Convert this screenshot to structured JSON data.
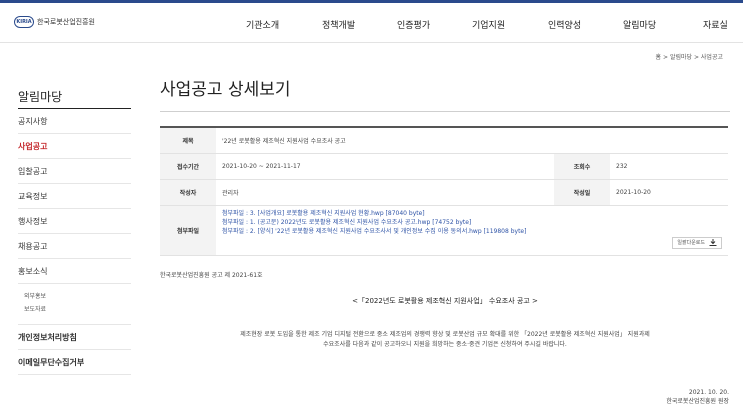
{
  "header": {
    "logo_mark": "KIRIA",
    "logo_text": "한국로봇산업진흥원",
    "logo_sub": "KOREA INSTITUTE FOR ROBOT INDUSTRY ADVANCEMENT",
    "nav": [
      "기관소개",
      "정책개발",
      "인증평가",
      "기업지원",
      "인력양성",
      "알림마당",
      "자료실"
    ]
  },
  "breadcrumb": {
    "home": "홈",
    "sep": ">",
    "level1": "알림마당",
    "level2": "사업공고"
  },
  "sidebar": {
    "title": "알림마당",
    "items": [
      {
        "label": "공지사항",
        "active": false
      },
      {
        "label": "사업공고",
        "active": true
      },
      {
        "label": "입찰공고",
        "active": false
      },
      {
        "label": "교육정보",
        "active": false
      },
      {
        "label": "행사정보",
        "active": false
      },
      {
        "label": "채용공고",
        "active": false
      },
      {
        "label": "홍보소식",
        "active": false
      }
    ],
    "sub_items": [
      "외부홍보",
      "보도자료"
    ],
    "bottom_items": [
      "개인정보처리방침",
      "이메일무단수집거부"
    ]
  },
  "main": {
    "page_title": "사업공고 상세보기",
    "detail": {
      "subject_label": "제목",
      "subject": "'22년 로봇활용 제조혁신 지원사업 수요조사 공고",
      "period_label": "접수기간",
      "period": "2021-10-20 ~ 2021-11-17",
      "views_label": "조회수",
      "views": "232",
      "author_label": "작성자",
      "author": "관리자",
      "date_label": "작성일",
      "date": "2021-10-20",
      "files_label": "첨부파일",
      "files": [
        "첨부파일 : 3. [사업개요] 로봇활용 제조혁신 지원사업 현황.hwp [87040 byte]",
        "첨부파일 : 1. (공고문) 2022년도 로봇활용 제조혁신 지원사업 수요조사 공고.hwp [74752 byte]",
        "첨부파일 : 2. [양식] '22년 로봇활용 제조혁신 지원사업 수요조사서 및 개인정보 수집 이용 동의서.hwp [119808 byte]"
      ],
      "zip_label": "일괄다운로드"
    },
    "notice_no": "한국로봇산업진흥원 공고 제 2021-61호",
    "announce_title": "<「2022년도 로봇활용 제조혁신 지원사업」 수요조사 공고 >",
    "body_line1": "제조현장 로봇 도입을 통한 제조 기업 디지털 전환으로 중소 제조업의 경쟁력 향상 및 로봇산업 규모 확대를 위한 「2022년 로봇활용 제조혁신 지원사업」 지원과제",
    "body_line2": "수요조사를 다음과 같이 공고하오니 지원을 희망하는 중소·중견 기업은 신청하여 주시길 바랍니다.",
    "footer_date": "2021. 10. 20.",
    "footer_org": "한국로봇산업진흥원 원장"
  },
  "colors": {
    "accent": "#c4282c",
    "brand": "#2a4a8c",
    "link": "#2e53a6"
  }
}
